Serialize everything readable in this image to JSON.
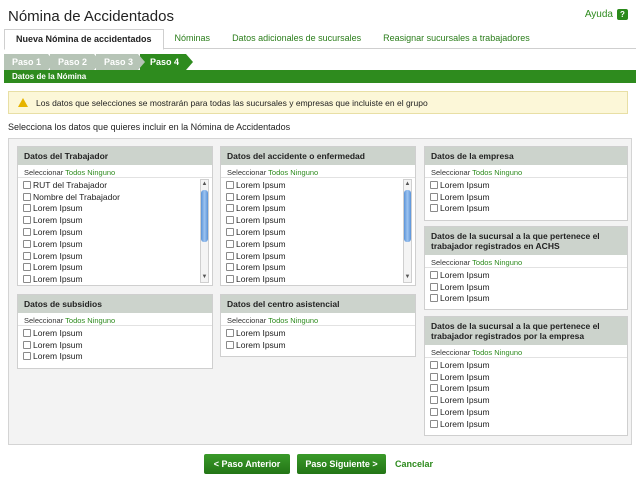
{
  "header": {
    "title": "Nómina de Accidentados",
    "help_label": "Ayuda",
    "help_icon": "question-icon"
  },
  "tabs": [
    {
      "label": "Nueva Nómina de accidentados",
      "active": true
    },
    {
      "label": "Nóminas"
    },
    {
      "label": "Datos adicionales de sucursales"
    },
    {
      "label": "Reasignar sucursales a trabajadores"
    }
  ],
  "steps": [
    "Paso 1",
    "Paso 2",
    "Paso 3",
    "Paso 4"
  ],
  "current_step": "Paso 4",
  "section_title": "Datos de la Nómina",
  "alert": {
    "text": "Los datos que selecciones se mostrarán para todas las sucursales y empresas que incluiste en el grupo",
    "icon": "warning-icon"
  },
  "instruction": "Selecciona los datos que quieres incluir en la Nómina de Accidentados",
  "select": {
    "label": "Seleccionar",
    "all": "Todos",
    "none": "Ninguno"
  },
  "groups": {
    "trabajador": {
      "title": "Datos del Trabajador",
      "items": [
        "RUT del Trabajador",
        "Nombre del Trabajador",
        "Lorem Ipsum",
        "Lorem Ipsum",
        "Lorem Ipsum",
        "Lorem Ipsum",
        "Lorem Ipsum",
        "Lorem Ipsum",
        "Lorem Ipsum"
      ]
    },
    "accidente": {
      "title": "Datos del accidente o enfermedad",
      "items": [
        "Lorem Ipsum",
        "Lorem Ipsum",
        "Lorem Ipsum",
        "Lorem Ipsum",
        "Lorem Ipsum",
        "Lorem Ipsum",
        "Lorem Ipsum",
        "Lorem Ipsum",
        "Lorem Ipsum"
      ]
    },
    "empresa": {
      "title": "Datos de la empresa",
      "items": [
        "Lorem Ipsum",
        "Lorem Ipsum",
        "Lorem Ipsum"
      ]
    },
    "subsidios": {
      "title": "Datos de subsidios",
      "items": [
        "Lorem Ipsum",
        "Lorem Ipsum",
        "Lorem Ipsum"
      ]
    },
    "centro": {
      "title": "Datos del centro asistencial",
      "items": [
        "Lorem Ipsum",
        "Lorem Ipsum"
      ]
    },
    "sucursal_achs": {
      "title": "Datos de la sucursal a la que pertenece el trabajador registrados en ACHS",
      "items": [
        "Lorem Ipsum",
        "Lorem Ipsum",
        "Lorem Ipsum"
      ]
    },
    "sucursal_empresa": {
      "title": "Datos de la sucursal a la que pertenece el trabajador registrados por la empresa",
      "items": [
        "Lorem Ipsum",
        "Lorem Ipsum",
        "Lorem Ipsum",
        "Lorem Ipsum",
        "Lorem Ipsum",
        "Lorem Ipsum"
      ]
    }
  },
  "buttons": {
    "prev": "< Paso Anterior",
    "next": "Paso Siguiente >",
    "cancel": "Cancelar"
  },
  "colors": {
    "brand_green": "#2e8b1e",
    "box_header": "#ccd3cc",
    "alert_bg": "#fcf7d8"
  }
}
